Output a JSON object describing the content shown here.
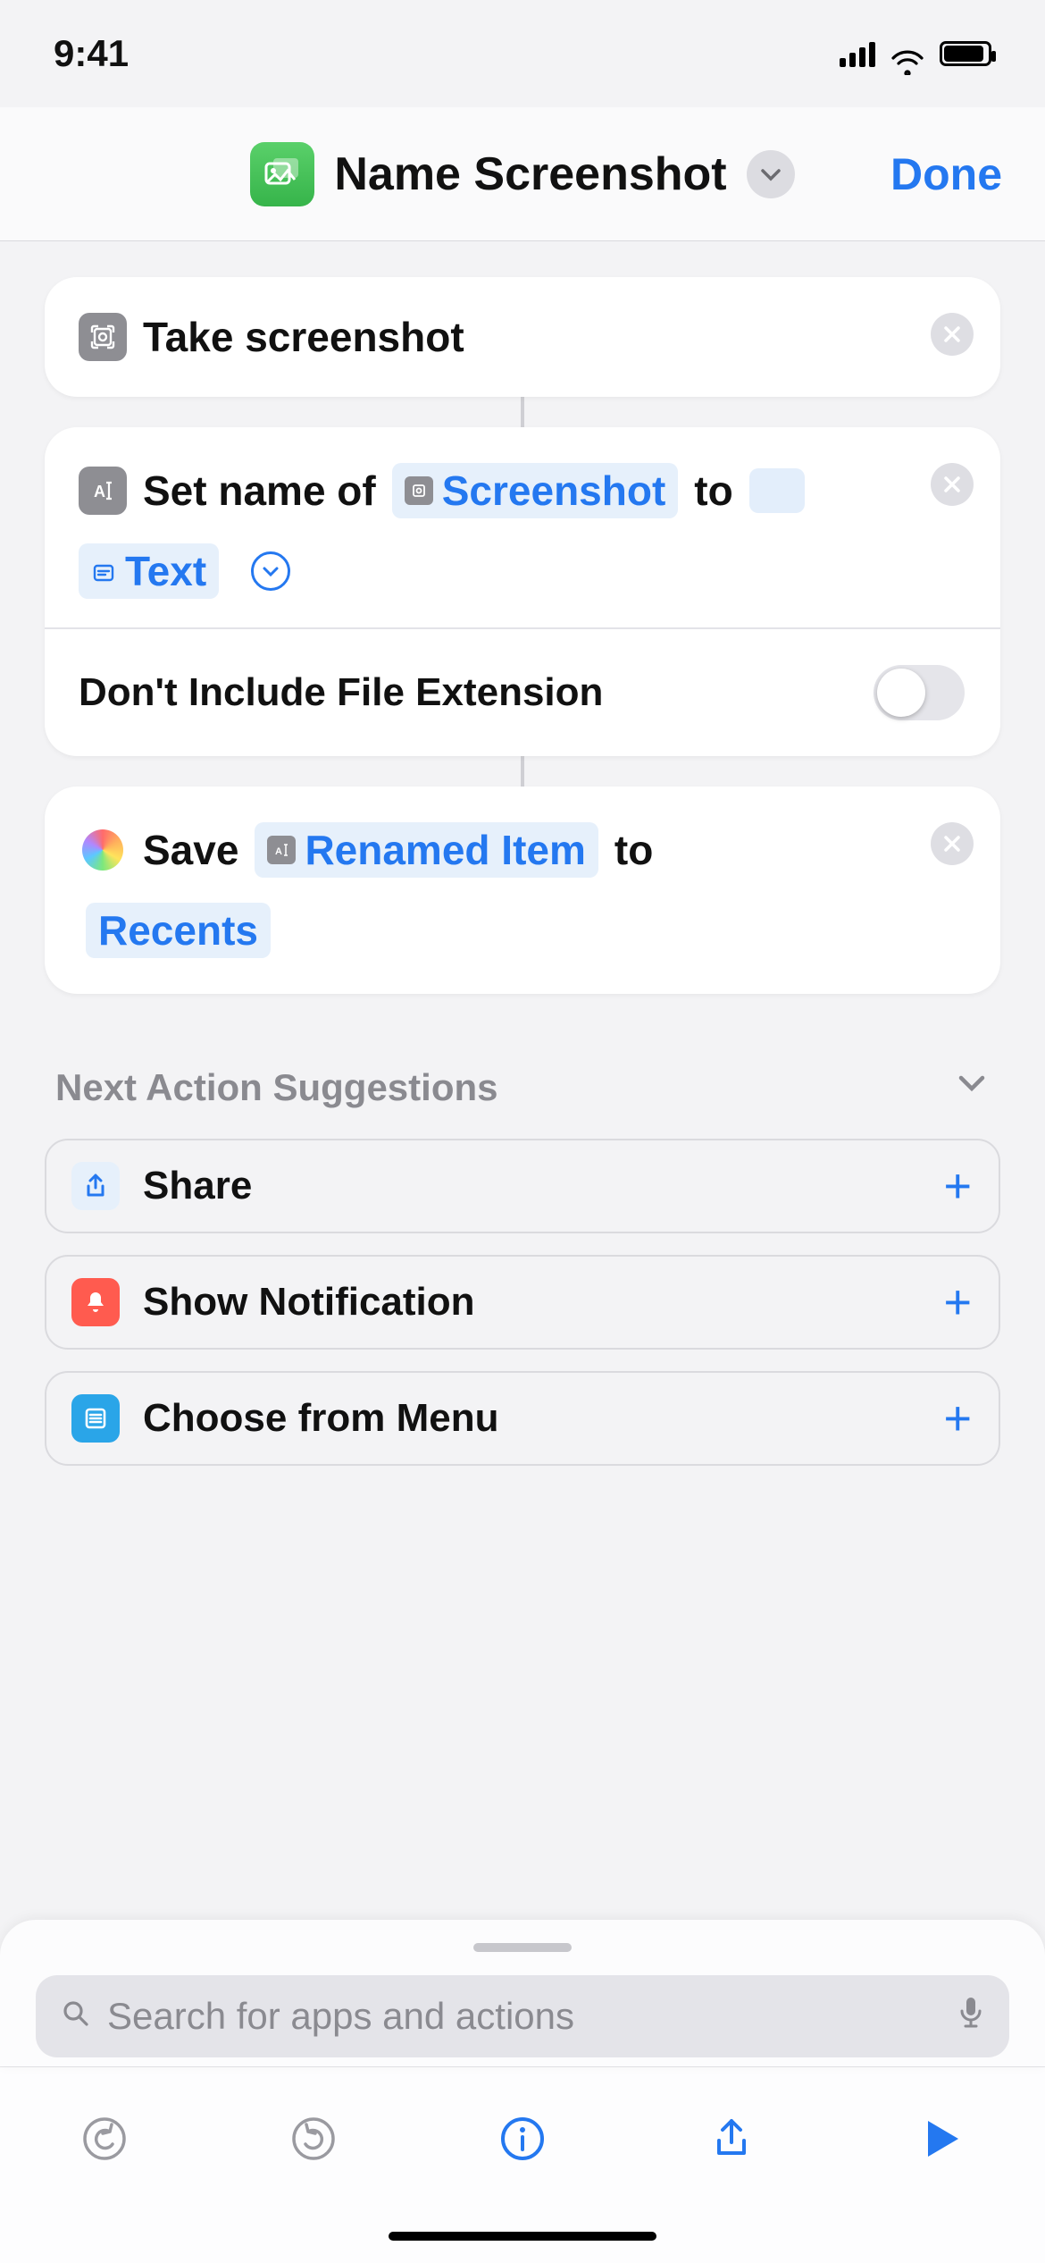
{
  "status": {
    "time": "9:41"
  },
  "header": {
    "title": "Name Screenshot",
    "done": "Done"
  },
  "actions": {
    "a1": {
      "label": "Take screenshot"
    },
    "a2": {
      "prefix": "Set name of",
      "var1": "Screenshot",
      "mid": "to",
      "var2": "Text",
      "option_label": "Don't Include File Extension"
    },
    "a3": {
      "prefix": "Save",
      "var1": "Renamed Item",
      "mid": "to",
      "dest": "Recents"
    }
  },
  "suggestions": {
    "title": "Next Action Suggestions",
    "items": [
      {
        "label": "Share"
      },
      {
        "label": "Show Notification"
      },
      {
        "label": "Choose from Menu"
      }
    ]
  },
  "search": {
    "placeholder": "Search for apps and actions"
  }
}
